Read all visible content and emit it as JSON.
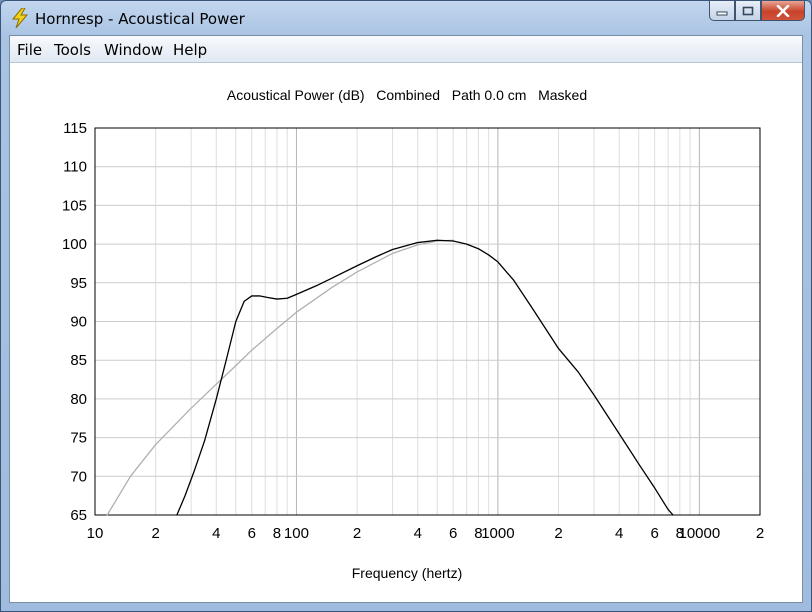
{
  "window": {
    "title": "Hornresp - Acoustical Power",
    "icon": "lightning-bolt-icon"
  },
  "menu": [
    "File",
    "Tools",
    "Window",
    "Help"
  ],
  "chart_data": {
    "type": "line",
    "title": "Acoustical Power (dB)   Combined   Path 0.0 cm   Masked",
    "xlabel": "Frequency (hertz)",
    "ylabel": "",
    "xscale": "log",
    "xlim": [
      10,
      20000
    ],
    "ylim": [
      65,
      115
    ],
    "grid": true,
    "y_ticks": [
      65,
      70,
      75,
      80,
      85,
      90,
      95,
      100,
      105,
      110,
      115
    ],
    "x_ticks": [
      {
        "value": 10,
        "label": "10"
      },
      {
        "value": 20,
        "label": "2"
      },
      {
        "value": 40,
        "label": "4"
      },
      {
        "value": 60,
        "label": "6"
      },
      {
        "value": 80,
        "label": "8"
      },
      {
        "value": 100,
        "label": "100"
      },
      {
        "value": 200,
        "label": "2"
      },
      {
        "value": 400,
        "label": "4"
      },
      {
        "value": 600,
        "label": "6"
      },
      {
        "value": 800,
        "label": "8"
      },
      {
        "value": 1000,
        "label": "1000"
      },
      {
        "value": 2000,
        "label": "2"
      },
      {
        "value": 4000,
        "label": "4"
      },
      {
        "value": 6000,
        "label": "6"
      },
      {
        "value": 8000,
        "label": "8"
      },
      {
        "value": 10000,
        "label": "10000"
      },
      {
        "value": 20000,
        "label": "2"
      }
    ],
    "series": [
      {
        "color": "#000000",
        "points": [
          [
            25.5,
            65
          ],
          [
            28,
            67.5
          ],
          [
            31,
            70.6
          ],
          [
            35,
            74.6
          ],
          [
            40,
            80
          ],
          [
            45,
            85.2
          ],
          [
            50,
            90
          ],
          [
            55,
            92.6
          ],
          [
            60,
            93.3
          ],
          [
            66,
            93.3
          ],
          [
            72,
            93.1
          ],
          [
            80,
            92.9
          ],
          [
            90,
            93.0
          ],
          [
            100,
            93.5
          ],
          [
            125,
            94.6
          ],
          [
            150,
            95.6
          ],
          [
            200,
            97.2
          ],
          [
            250,
            98.4
          ],
          [
            300,
            99.3
          ],
          [
            400,
            100.2
          ],
          [
            500,
            100.5
          ],
          [
            600,
            100.4
          ],
          [
            700,
            100.0
          ],
          [
            800,
            99.4
          ],
          [
            900,
            98.6
          ],
          [
            1000,
            97.7
          ],
          [
            1200,
            95.3
          ],
          [
            1500,
            91.5
          ],
          [
            2000,
            86.5
          ],
          [
            2500,
            83.5
          ],
          [
            3000,
            80.5
          ],
          [
            4000,
            75.5
          ],
          [
            5000,
            71.6
          ],
          [
            6000,
            68.5
          ],
          [
            7000,
            65.7
          ],
          [
            7400,
            65
          ]
        ]
      },
      {
        "color": "#b0b0b0",
        "points": [
          [
            11.5,
            65
          ],
          [
            15,
            70
          ],
          [
            20,
            74.1
          ],
          [
            30,
            78.8
          ],
          [
            40,
            81.9
          ],
          [
            50,
            84.3
          ],
          [
            60,
            86.3
          ],
          [
            80,
            89.1
          ],
          [
            100,
            91.2
          ],
          [
            150,
            94.4
          ],
          [
            200,
            96.4
          ],
          [
            300,
            98.8
          ],
          [
            400,
            99.9
          ],
          [
            500,
            100.4
          ],
          [
            600,
            100.5
          ]
        ]
      }
    ]
  }
}
